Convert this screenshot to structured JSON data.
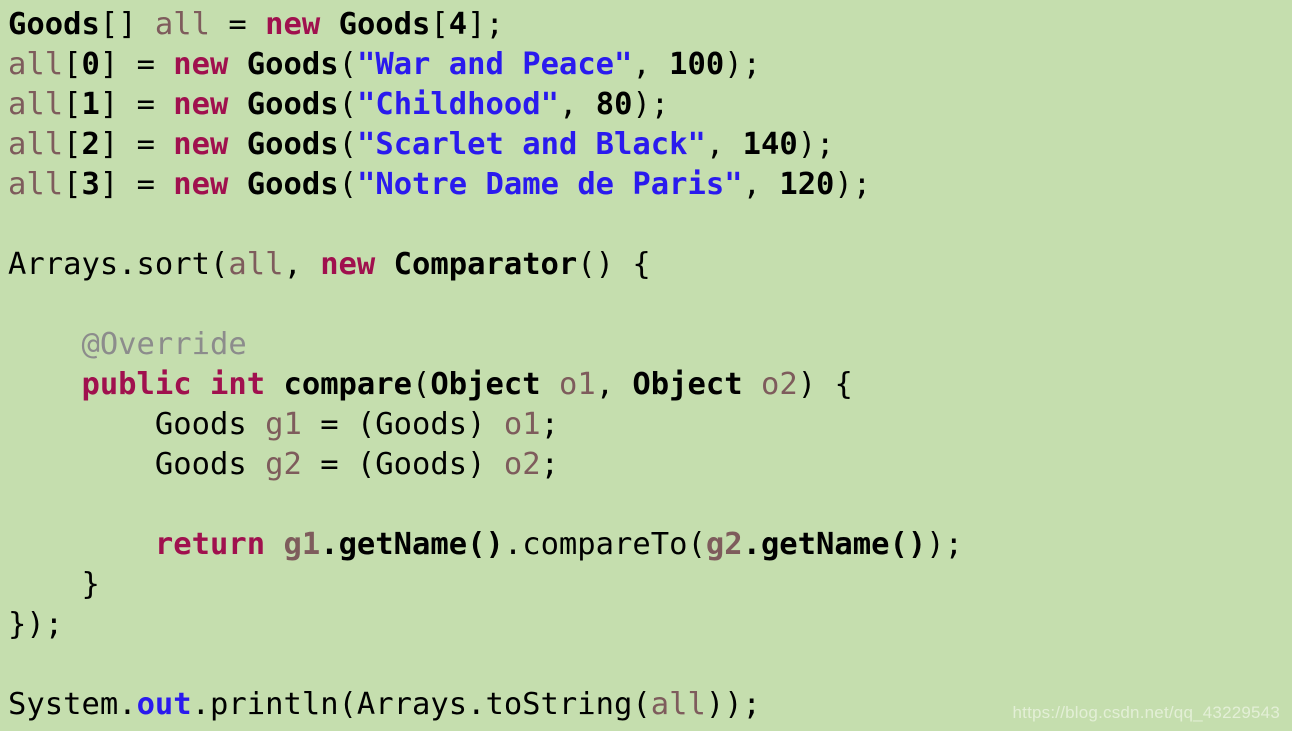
{
  "editor": {
    "language": "java",
    "background_color": "#c5deae",
    "font_size_px": 30.5,
    "line_height_px": 40,
    "theme_colors": {
      "plain": "#000000",
      "class": "#000000",
      "keyword": "#a0104e",
      "string": "#2a1aee",
      "field": "#2a1aee",
      "identifier": "#7e5c5c",
      "number": "#000000",
      "comment": "#8c8c8c",
      "watermark": "#e3efd6"
    }
  },
  "watermark": {
    "text": "https://blog.csdn.net/qq_43229543"
  },
  "code": {
    "plain_text": "Goods[] all = new Goods[4];\nall[0] = new Goods(\"War and Peace\", 100);\nall[1] = new Goods(\"Childhood\", 80);\nall[2] = new Goods(\"Scarlet and Black\", 140);\nall[3] = new Goods(\"Notre Dame de Paris\", 120);\n\nArrays.sort(all, new Comparator() {\n\n    @Override\n    public int compare(Object o1, Object o2) {\n        Goods g1 = (Goods) o1;\n        Goods g2 = (Goods) o2;\n\n        return g1.getName().compareTo(g2.getName());\n    }\n});\n\nSystem.out.println(Arrays.toString(all));",
    "lines": [
      {
        "n": 1,
        "tokens": [
          {
            "t": "Goods",
            "c": "class"
          },
          {
            "t": "[] ",
            "c": "plain"
          },
          {
            "t": "all",
            "c": "ident"
          },
          {
            "t": " = ",
            "c": "plain"
          },
          {
            "t": "new",
            "c": "keyword"
          },
          {
            "t": " ",
            "c": "plain"
          },
          {
            "t": "Goods",
            "c": "class"
          },
          {
            "t": "[",
            "c": "plain"
          },
          {
            "t": "4",
            "c": "number"
          },
          {
            "t": "];",
            "c": "plain"
          }
        ]
      },
      {
        "n": 2,
        "tokens": [
          {
            "t": "all",
            "c": "ident"
          },
          {
            "t": "[",
            "c": "plain"
          },
          {
            "t": "0",
            "c": "number"
          },
          {
            "t": "] = ",
            "c": "plain"
          },
          {
            "t": "new",
            "c": "keyword"
          },
          {
            "t": " ",
            "c": "plain"
          },
          {
            "t": "Goods",
            "c": "class"
          },
          {
            "t": "(",
            "c": "plain"
          },
          {
            "t": "\"War and Peace\"",
            "c": "string"
          },
          {
            "t": ", ",
            "c": "plain"
          },
          {
            "t": "100",
            "c": "number"
          },
          {
            "t": ");",
            "c": "plain"
          }
        ]
      },
      {
        "n": 3,
        "tokens": [
          {
            "t": "all",
            "c": "ident"
          },
          {
            "t": "[",
            "c": "plain"
          },
          {
            "t": "1",
            "c": "number"
          },
          {
            "t": "] = ",
            "c": "plain"
          },
          {
            "t": "new",
            "c": "keyword"
          },
          {
            "t": " ",
            "c": "plain"
          },
          {
            "t": "Goods",
            "c": "class"
          },
          {
            "t": "(",
            "c": "plain"
          },
          {
            "t": "\"Childhood\"",
            "c": "string"
          },
          {
            "t": ", ",
            "c": "plain"
          },
          {
            "t": "80",
            "c": "number"
          },
          {
            "t": ");",
            "c": "plain"
          }
        ]
      },
      {
        "n": 4,
        "tokens": [
          {
            "t": "all",
            "c": "ident"
          },
          {
            "t": "[",
            "c": "plain"
          },
          {
            "t": "2",
            "c": "number"
          },
          {
            "t": "] = ",
            "c": "plain"
          },
          {
            "t": "new",
            "c": "keyword"
          },
          {
            "t": " ",
            "c": "plain"
          },
          {
            "t": "Goods",
            "c": "class"
          },
          {
            "t": "(",
            "c": "plain"
          },
          {
            "t": "\"Scarlet and Black\"",
            "c": "string"
          },
          {
            "t": ", ",
            "c": "plain"
          },
          {
            "t": "140",
            "c": "number"
          },
          {
            "t": ");",
            "c": "plain"
          }
        ]
      },
      {
        "n": 5,
        "tokens": [
          {
            "t": "all",
            "c": "ident"
          },
          {
            "t": "[",
            "c": "plain"
          },
          {
            "t": "3",
            "c": "number"
          },
          {
            "t": "] = ",
            "c": "plain"
          },
          {
            "t": "new",
            "c": "keyword"
          },
          {
            "t": " ",
            "c": "plain"
          },
          {
            "t": "Goods",
            "c": "class"
          },
          {
            "t": "(",
            "c": "plain"
          },
          {
            "t": "\"Notre Dame de Paris\"",
            "c": "string"
          },
          {
            "t": ", ",
            "c": "plain"
          },
          {
            "t": "120",
            "c": "number"
          },
          {
            "t": ");",
            "c": "plain"
          }
        ]
      },
      {
        "n": 6,
        "tokens": []
      },
      {
        "n": 7,
        "tokens": [
          {
            "t": "Arrays.sort(",
            "c": "plain"
          },
          {
            "t": "all",
            "c": "ident"
          },
          {
            "t": ", ",
            "c": "plain"
          },
          {
            "t": "new",
            "c": "keyword"
          },
          {
            "t": " ",
            "c": "plain"
          },
          {
            "t": "Comparator",
            "c": "class"
          },
          {
            "t": "() {",
            "c": "plain"
          }
        ]
      },
      {
        "n": 8,
        "tokens": []
      },
      {
        "n": 9,
        "tokens": [
          {
            "t": "    ",
            "c": "plain"
          },
          {
            "t": "@Override",
            "c": "comment"
          }
        ]
      },
      {
        "n": 10,
        "tokens": [
          {
            "t": "    ",
            "c": "plain"
          },
          {
            "t": "public int",
            "c": "keyword"
          },
          {
            "t": " ",
            "c": "plain"
          },
          {
            "t": "compare",
            "c": "class"
          },
          {
            "t": "(",
            "c": "plain"
          },
          {
            "t": "Object",
            "c": "class"
          },
          {
            "t": " ",
            "c": "plain"
          },
          {
            "t": "o1",
            "c": "ident"
          },
          {
            "t": ", ",
            "c": "plain"
          },
          {
            "t": "Object",
            "c": "class"
          },
          {
            "t": " ",
            "c": "plain"
          },
          {
            "t": "o2",
            "c": "ident"
          },
          {
            "t": ") {",
            "c": "plain"
          }
        ]
      },
      {
        "n": 11,
        "tokens": [
          {
            "t": "        ",
            "c": "plain"
          },
          {
            "t": "Goods",
            "c": "plain"
          },
          {
            "t": " ",
            "c": "plain"
          },
          {
            "t": "g1",
            "c": "ident"
          },
          {
            "t": " = (",
            "c": "plain"
          },
          {
            "t": "Goods",
            "c": "plain"
          },
          {
            "t": ") ",
            "c": "plain"
          },
          {
            "t": "o1",
            "c": "ident"
          },
          {
            "t": ";",
            "c": "plain"
          }
        ]
      },
      {
        "n": 12,
        "tokens": [
          {
            "t": "        ",
            "c": "plain"
          },
          {
            "t": "Goods",
            "c": "plain"
          },
          {
            "t": " ",
            "c": "plain"
          },
          {
            "t": "g2",
            "c": "ident"
          },
          {
            "t": " = (",
            "c": "plain"
          },
          {
            "t": "Goods",
            "c": "plain"
          },
          {
            "t": ") ",
            "c": "plain"
          },
          {
            "t": "o2",
            "c": "ident"
          },
          {
            "t": ";",
            "c": "plain"
          }
        ]
      },
      {
        "n": 13,
        "tokens": []
      },
      {
        "n": 14,
        "tokens": [
          {
            "t": "        ",
            "c": "plain"
          },
          {
            "t": "return",
            "c": "keyword"
          },
          {
            "t": " ",
            "c": "plain"
          },
          {
            "t": "g1",
            "c": "identb"
          },
          {
            "t": ".getName()",
            "c": "class"
          },
          {
            "t": ".compareTo(",
            "c": "plain"
          },
          {
            "t": "g2",
            "c": "identb"
          },
          {
            "t": ".getName()",
            "c": "class"
          },
          {
            "t": ");",
            "c": "plain"
          }
        ]
      },
      {
        "n": 15,
        "tokens": [
          {
            "t": "    }",
            "c": "plain"
          }
        ]
      },
      {
        "n": 16,
        "tokens": [
          {
            "t": "});",
            "c": "plain"
          }
        ]
      },
      {
        "n": 17,
        "tokens": []
      },
      {
        "n": 18,
        "tokens": [
          {
            "t": "System",
            "c": "plain"
          },
          {
            "t": ".",
            "c": "plain"
          },
          {
            "t": "out",
            "c": "field"
          },
          {
            "t": ".println(Arrays.toString(",
            "c": "plain"
          },
          {
            "t": "all",
            "c": "ident"
          },
          {
            "t": "));",
            "c": "plain"
          }
        ]
      }
    ]
  }
}
